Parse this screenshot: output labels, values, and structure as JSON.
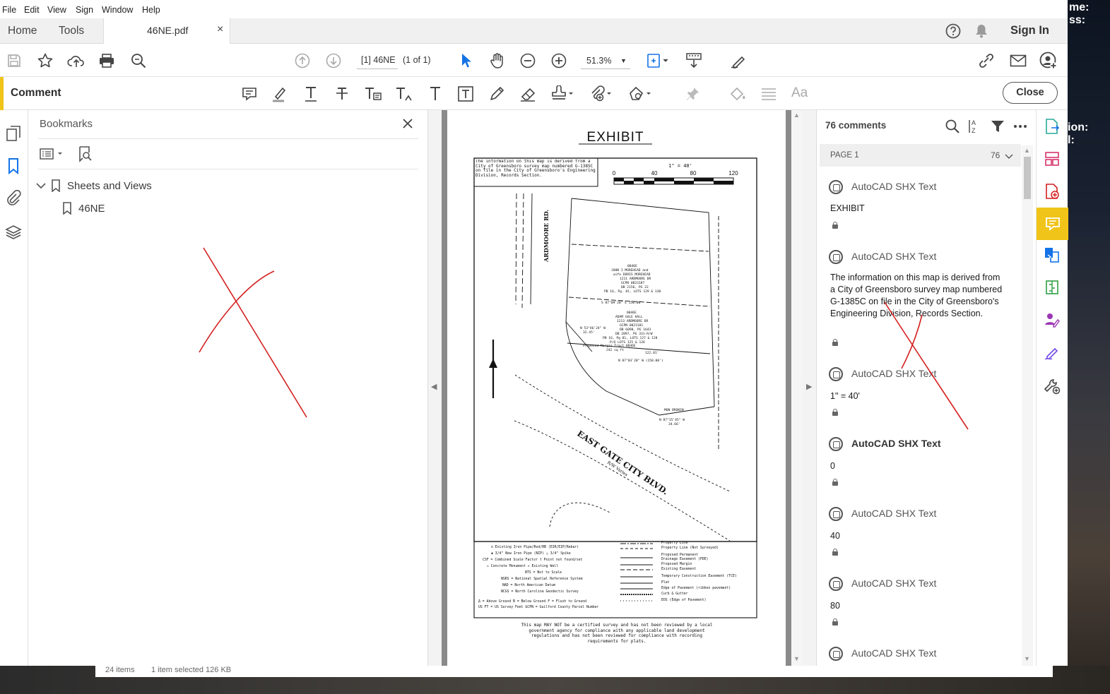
{
  "menu": [
    "File",
    "Edit",
    "View",
    "Sign",
    "Window",
    "Help"
  ],
  "tabs": {
    "home": "Home",
    "tools": "Tools",
    "document": "46NE.pdf",
    "close_symbol": "×"
  },
  "header": {
    "sign_in": "Sign In"
  },
  "toolbar": {
    "page_field": "[1] 46NE",
    "page_count": "(1 of 1)",
    "zoom": "51.3%"
  },
  "comment_bar": {
    "label": "Comment",
    "close": "Close",
    "text_tool": "Aa"
  },
  "bookmarks": {
    "title": "Bookmarks",
    "items": [
      {
        "label": "Sheets and Views"
      },
      {
        "label": "46NE"
      }
    ]
  },
  "document": {
    "title": "EXHIBIT",
    "scale_label": "1\" = 40'",
    "scale_ticks": [
      "0",
      "40",
      "80",
      "120"
    ],
    "note": "The information on this map is derived from a City of Greensboro survey map numbered G-1385C on file in the City of Greensboro's Engineering Division, Records Section.",
    "road_1": "ARDMOORE RD.",
    "road_2": "EAST GATE CITY BLVD.",
    "road_2_sub": "R/W Varies",
    "disclaimer": "This map MAY NOT be a certified survey and has not been reviewed by a local government agency for compliance with any applicable land development regulations and has not been reviewed for compliance with recording requirements for plats."
  },
  "comments": {
    "count_label": "76 comments",
    "page_header": "PAGE 1",
    "page_count": "76",
    "items": [
      {
        "author": "AutoCAD SHX Text",
        "body": "EXHIBIT"
      },
      {
        "author": "AutoCAD SHX Text",
        "body": "The information on this map is derived from a City of Greensboro survey map numbered G-1385C on file in the City  of Greensboro's Engineering Division, Records Section."
      },
      {
        "author": "AutoCAD SHX Text",
        "body": "1\" = 40'"
      },
      {
        "author": "AutoCAD SHX Text",
        "body": "0"
      },
      {
        "author": "AutoCAD SHX Text",
        "body": "40"
      },
      {
        "author": "AutoCAD SHX Text",
        "body": "80"
      },
      {
        "author": "AutoCAD SHX Text",
        "body": ""
      }
    ]
  },
  "statusbar": {
    "items": "24 items",
    "selected": "1 item selected  126 KB"
  },
  "desktop": {
    "line1": "me:",
    "line2": "ss:",
    "line3": "ion:",
    "line4": "l:"
  },
  "colors": {
    "accent": "#f0c419",
    "annotation_red": "#d42020",
    "link_blue": "#1473e6"
  }
}
